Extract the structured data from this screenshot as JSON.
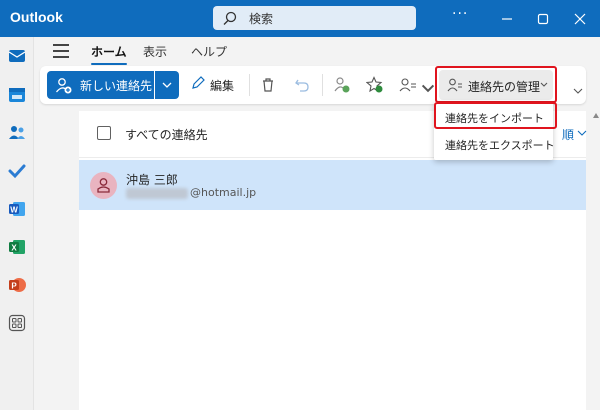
{
  "app": {
    "title": "Outlook"
  },
  "search": {
    "placeholder": "検索"
  },
  "window": {
    "more": "···"
  },
  "tabs": [
    {
      "label": "ホーム"
    },
    {
      "label": "表示"
    },
    {
      "label": "ヘルプ"
    }
  ],
  "ribbon": {
    "new_contact": "新しい連絡先",
    "edit": "編集",
    "manage_contacts": "連絡先の管理"
  },
  "manage_menu": {
    "items": [
      {
        "label": "連絡先をインポート"
      },
      {
        "label": "連絡先をエクスポート"
      }
    ]
  },
  "list": {
    "title": "すべての連絡先",
    "sort_label": "順",
    "contacts": [
      {
        "name": "沖島 三郎",
        "email_domain": "@hotmail.jp"
      }
    ]
  },
  "colors": {
    "brand": "#0f6cbd",
    "highlight": "#e0141e",
    "selected_row": "#cfe4fa"
  },
  "rail_icons": [
    "mail-icon",
    "calendar-icon",
    "people-icon",
    "todo-icon",
    "word-icon",
    "excel-icon",
    "powerpoint-icon",
    "apps-icon"
  ]
}
